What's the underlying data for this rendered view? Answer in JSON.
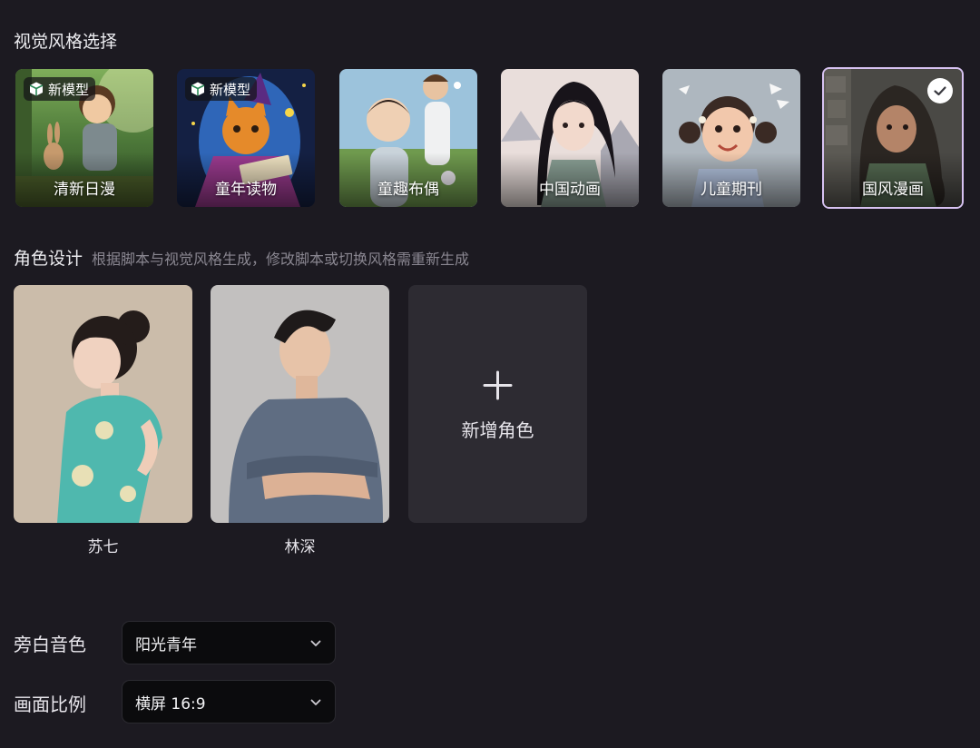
{
  "visual_style": {
    "title": "视觉风格选择",
    "badge_label": "新模型",
    "items": [
      {
        "label": "清新日漫",
        "new_model": true,
        "selected": false
      },
      {
        "label": "童年读物",
        "new_model": true,
        "selected": false
      },
      {
        "label": "童趣布偶",
        "new_model": false,
        "selected": false
      },
      {
        "label": "中国动画",
        "new_model": false,
        "selected": false
      },
      {
        "label": "儿童期刊",
        "new_model": false,
        "selected": false
      },
      {
        "label": "国风漫画",
        "new_model": false,
        "selected": true
      }
    ],
    "selected_check_icon": "check-circle-icon",
    "badge_icon": "cube-icon"
  },
  "characters": {
    "title": "角色设计",
    "subtitle": "根据脚本与视觉风格生成，修改脚本或切换风格需重新生成",
    "items": [
      {
        "name": "苏七"
      },
      {
        "name": "林深"
      }
    ],
    "add_label": "新增角色",
    "add_icon": "plus-icon"
  },
  "settings": {
    "narration_voice": {
      "label": "旁白音色",
      "value": "阳光青年"
    },
    "aspect_ratio": {
      "label": "画面比例",
      "value": "横屏 16:9"
    },
    "dropdown_icon": "chevron-down-icon"
  },
  "colors": {
    "background": "#1c1a21",
    "select_bg": "#0b0b0d",
    "add_card_bg": "#2d2b32",
    "selected_border": "#d7c2f2"
  }
}
